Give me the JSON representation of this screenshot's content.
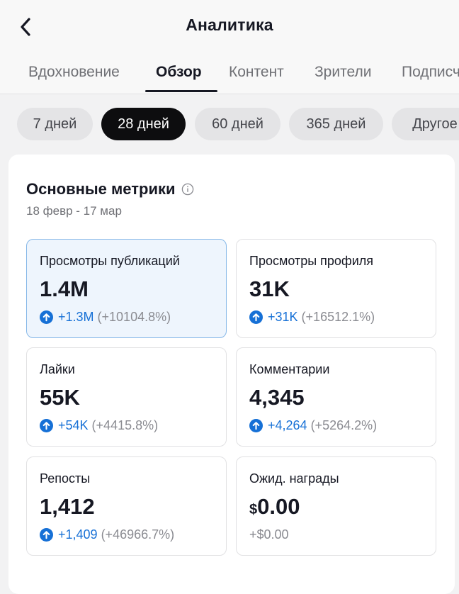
{
  "header": {
    "title": "Аналитика",
    "back_icon": "chevron-left-icon"
  },
  "tabs": [
    {
      "label": "Вдохновение",
      "active": false
    },
    {
      "label": "Обзор",
      "active": true
    },
    {
      "label": "Контент",
      "active": false
    },
    {
      "label": "Зрители",
      "active": false
    },
    {
      "label": "Подписчики",
      "active": false
    }
  ],
  "periods": [
    {
      "label": "7 дней",
      "active": false
    },
    {
      "label": "28 дней",
      "active": true
    },
    {
      "label": "60 дней",
      "active": false
    },
    {
      "label": "365 дней",
      "active": false
    },
    {
      "label": "Другое",
      "active": false
    }
  ],
  "metrics_section": {
    "title": "Основные метрики",
    "info_icon": "info-icon",
    "date_range": "18 февр - 17 мар",
    "items": [
      {
        "label": "Просмотры публикаций",
        "value": "1.4M",
        "change": "+1.3M",
        "change_pct": "(+10104.8%)",
        "selected": true
      },
      {
        "label": "Просмотры профиля",
        "value": "31K",
        "change": "+31K",
        "change_pct": "(+16512.1%)",
        "selected": false
      },
      {
        "label": "Лайки",
        "value": "55K",
        "change": "+54K",
        "change_pct": "(+4415.8%)",
        "selected": false
      },
      {
        "label": "Комментарии",
        "value": "4,345",
        "change": "+4,264",
        "change_pct": "(+5264.2%)",
        "selected": false
      },
      {
        "label": "Репосты",
        "value": "1,412",
        "change": "+1,409",
        "change_pct": "(+46966.7%)",
        "selected": false
      },
      {
        "label": "Ожид. награды",
        "currency": "$",
        "value": "0.00",
        "change": "+$0.00",
        "selected": false
      }
    ]
  },
  "colors": {
    "accent_blue": "#1670d6",
    "selected_border": "#86b8e8",
    "selected_bg": "#eef5fd",
    "active_chip_bg": "#0d0d0f"
  }
}
